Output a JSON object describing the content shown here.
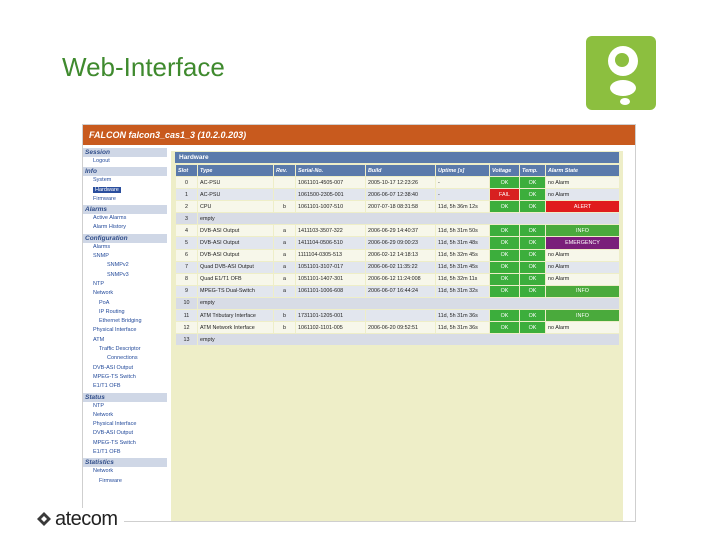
{
  "slide": {
    "title": "Web-Interface",
    "footer_brand": "atecom"
  },
  "window": {
    "title": "FALCON falcon3_cas1_3 (10.2.0.203)"
  },
  "sidebar": [
    {
      "label": "Session",
      "type": "head"
    },
    {
      "label": "Logout",
      "type": "item",
      "level": 1
    },
    {
      "label": "Info",
      "type": "head"
    },
    {
      "label": "System",
      "type": "item",
      "level": 1
    },
    {
      "label": "Hardware",
      "type": "item",
      "level": 1,
      "selected": true
    },
    {
      "label": "Firmware",
      "type": "item",
      "level": 1
    },
    {
      "label": "Alarms",
      "type": "head"
    },
    {
      "label": "Active Alarms",
      "type": "item",
      "level": 1
    },
    {
      "label": "Alarm History",
      "type": "item",
      "level": 1
    },
    {
      "label": "Configuration",
      "type": "head"
    },
    {
      "label": "Alarms",
      "type": "item",
      "level": 1
    },
    {
      "label": "SNMP",
      "type": "item",
      "level": 1
    },
    {
      "label": "SNMPv2",
      "type": "item",
      "level": 3
    },
    {
      "label": "SNMPv3",
      "type": "item",
      "level": 3
    },
    {
      "label": "NTP",
      "type": "item",
      "level": 1
    },
    {
      "label": "Network",
      "type": "item",
      "level": 1
    },
    {
      "label": "PoA",
      "type": "item",
      "level": 2
    },
    {
      "label": "IP Routing",
      "type": "item",
      "level": 2
    },
    {
      "label": "Ethernet Bridging",
      "type": "item",
      "level": 2
    },
    {
      "label": "Physical Interface",
      "type": "item",
      "level": 1
    },
    {
      "label": "ATM",
      "type": "item",
      "level": 1
    },
    {
      "label": "Traffic Descriptor",
      "type": "item",
      "level": 2
    },
    {
      "label": "Connections",
      "type": "item",
      "level": 3
    },
    {
      "label": "DVB-ASI Output",
      "type": "item",
      "level": 1
    },
    {
      "label": "MPEG-TS Switch",
      "type": "item",
      "level": 1
    },
    {
      "label": "E1/T1 OFB",
      "type": "item",
      "level": 1
    },
    {
      "label": "Status",
      "type": "head"
    },
    {
      "label": "NTP",
      "type": "item",
      "level": 1
    },
    {
      "label": "Network",
      "type": "item",
      "level": 1
    },
    {
      "label": "Physical Interface",
      "type": "item",
      "level": 1
    },
    {
      "label": "DVB-ASI Output",
      "type": "item",
      "level": 1
    },
    {
      "label": "MPEG-TS Switch",
      "type": "item",
      "level": 1
    },
    {
      "label": "E1/T1 OFB",
      "type": "item",
      "level": 1
    },
    {
      "label": "Statistics",
      "type": "head"
    },
    {
      "label": "Network",
      "type": "item",
      "level": 1
    },
    {
      "label": "Firmware",
      "type": "item",
      "level": 2
    }
  ],
  "hardware": {
    "header": "Hardware",
    "columns": [
      "Slot",
      "Type",
      "Rev.",
      "Serial-No.",
      "Build",
      "Uptime [s]",
      "Voltage",
      "Temp.",
      "Alarm State"
    ],
    "rows": [
      {
        "slot": "0",
        "type": "AC-PSU",
        "rev": "",
        "serial": "1061101-4505-007",
        "build": "2005-10-17 12:23:26",
        "uptime": "-",
        "voltage": "OK",
        "voltage_state": "ok",
        "temp": "OK",
        "temp_state": "ok",
        "alarm": "no Alarm",
        "alarm_state": "normal"
      },
      {
        "slot": "1",
        "type": "AC-PSU",
        "rev": "",
        "serial": "1061500-2305-001",
        "build": "2006-06-07 12:38:40",
        "uptime": "-",
        "voltage": "FAIL",
        "voltage_state": "fail",
        "temp": "OK",
        "temp_state": "ok",
        "alarm": "no Alarm",
        "alarm_state": "normal"
      },
      {
        "slot": "2",
        "type": "CPU",
        "rev": "b",
        "serial": "1061101-1007-510",
        "build": "2007-07-18 08:31:58",
        "uptime": "11d, 5h 36m 12s",
        "voltage": "OK",
        "voltage_state": "ok",
        "temp": "OK",
        "temp_state": "ok",
        "alarm": "ALERT",
        "alarm_state": "alert"
      },
      {
        "slot": "3",
        "type": "empty",
        "empty": true
      },
      {
        "slot": "4",
        "type": "DVB-ASI Output",
        "rev": "a",
        "serial": "1411103-3507-322",
        "build": "2006-06-29 14:40:37",
        "uptime": "11d, 5h 31m 50s",
        "voltage": "OK",
        "voltage_state": "ok",
        "temp": "OK",
        "temp_state": "ok",
        "alarm": "INFO",
        "alarm_state": "info"
      },
      {
        "slot": "5",
        "type": "DVB-ASI Output",
        "rev": "a",
        "serial": "1411104-0506-510",
        "build": "2006-06-29 09:00:23",
        "uptime": "11d, 5h 31m 48s",
        "voltage": "OK",
        "voltage_state": "ok",
        "temp": "OK",
        "temp_state": "ok",
        "alarm": "EMERGENCY",
        "alarm_state": "emergency"
      },
      {
        "slot": "6",
        "type": "DVB-ASI Output",
        "rev": "a",
        "serial": "1111104-0305-513",
        "build": "2006-02-12 14:18:13",
        "uptime": "11d, 5h 32m 45s",
        "voltage": "OK",
        "voltage_state": "ok",
        "temp": "OK",
        "temp_state": "ok",
        "alarm": "no Alarm",
        "alarm_state": "normal"
      },
      {
        "slot": "7",
        "type": "Quad DVB-ASI Output",
        "rev": "a",
        "serial": "1051101-3107-017",
        "build": "2006-06-02 11:35:22",
        "uptime": "11d, 5h 31m 45s",
        "voltage": "OK",
        "voltage_state": "ok",
        "temp": "OK",
        "temp_state": "ok",
        "alarm": "no Alarm",
        "alarm_state": "normal"
      },
      {
        "slot": "8",
        "type": "Quad E1/T1 OFB",
        "rev": "a",
        "serial": "1051101-1407-301",
        "build": "2006-06-12 11:24:008",
        "uptime": "11d, 5h 32m 11s",
        "voltage": "OK",
        "voltage_state": "ok",
        "temp": "OK",
        "temp_state": "ok",
        "alarm": "no Alarm",
        "alarm_state": "normal"
      },
      {
        "slot": "9",
        "type": "MPEG-TS Dual-Switch",
        "rev": "a",
        "serial": "1061101-1006-608",
        "build": "2006-06-07 16:44:24",
        "uptime": "11d, 5h 31m 32s",
        "voltage": "OK",
        "voltage_state": "ok",
        "temp": "OK",
        "temp_state": "ok",
        "alarm": "INFO",
        "alarm_state": "info"
      },
      {
        "slot": "10",
        "type": "empty",
        "empty": true
      },
      {
        "slot": "11",
        "type": "ATM Tributary Interface",
        "rev": "b",
        "serial": "1731101-1205-001",
        "build": "",
        "uptime": "11d, 5h 31m 36s",
        "voltage": "OK",
        "voltage_state": "ok",
        "temp": "OK",
        "temp_state": "ok",
        "alarm": "INFO",
        "alarm_state": "info"
      },
      {
        "slot": "12",
        "type": "ATM Network Interface",
        "rev": "b",
        "serial": "1061102-1101-005",
        "build": "2006-06-20 09:52:51",
        "uptime": "11d, 5h 31m 36s",
        "voltage": "OK",
        "voltage_state": "ok",
        "temp": "OK",
        "temp_state": "ok",
        "alarm": "no Alarm",
        "alarm_state": "normal"
      },
      {
        "slot": "13",
        "type": "empty",
        "empty": true
      }
    ]
  },
  "icons": {
    "logo_tile": "leaf-logo-icon",
    "footer_mark": "atecom-mark-icon"
  },
  "colors": {
    "title_green": "#3f8a2e",
    "topbar_orange": "#c85a1e",
    "status_ok": "#3cae3c",
    "status_fail": "#d82020",
    "alarm_emergency": "#7a1f7a"
  }
}
